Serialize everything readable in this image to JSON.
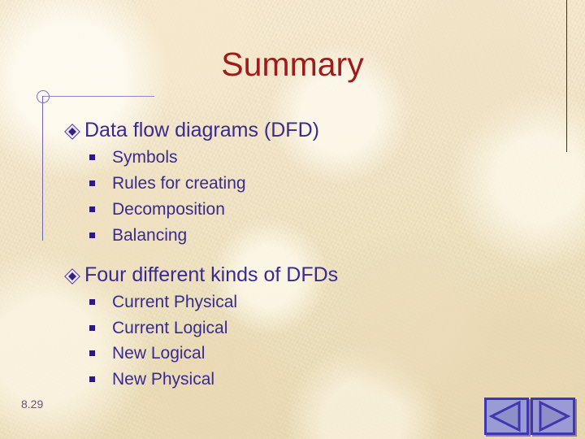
{
  "slide": {
    "title": "Summary",
    "page_number": "8.29",
    "title_color": "#9e1b1b",
    "text_color": "#3a2a8f",
    "background_color": "#ece0bd",
    "bullet_l1_icon": "diamond-bullet-icon",
    "bullet_l2_icon": "square-bullet-icon",
    "groups": [
      {
        "heading": "Data flow diagrams (DFD)",
        "items": [
          "Symbols",
          "Rules for creating",
          "Decomposition",
          "Balancing"
        ]
      },
      {
        "heading": "Four different kinds of DFDs",
        "items": [
          "Current Physical",
          "Current Logical",
          "New Logical",
          "New Physical"
        ]
      }
    ]
  },
  "nav": {
    "prev_label": "Previous slide",
    "next_label": "Next slide",
    "prev_icon": "triangle-left-icon",
    "next_icon": "triangle-right-icon",
    "button_fill": "#9a9ad4",
    "button_border": "#3f37b0"
  }
}
